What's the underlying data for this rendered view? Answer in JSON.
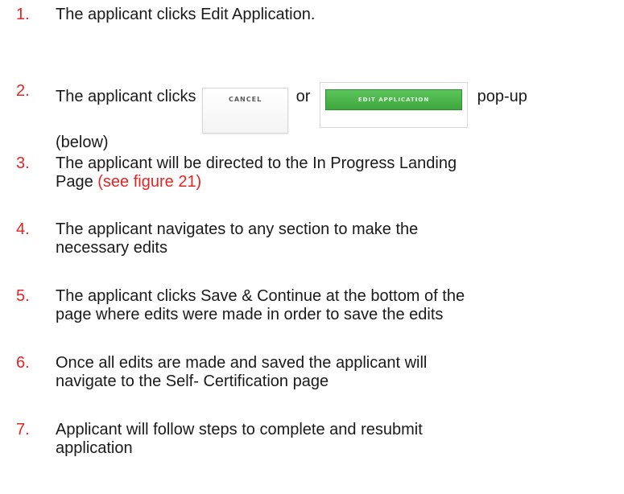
{
  "steps": [
    {
      "number": "1.",
      "text": "The applicant clicks Edit Application."
    },
    {
      "number": "2.",
      "before": "The applicant clicks",
      "cancel_label": "CANCEL",
      "connector": "or",
      "edit_label": "EDIT APPLICATION",
      "after_line1": "pop-up",
      "after_line2": "(below)"
    },
    {
      "number": "3.",
      "line1": "The applicant will be directed to the In Progress Landing",
      "line2_plain": "Page ",
      "line2_ref": "(see figure 21)"
    },
    {
      "number": "4.",
      "line1": "The applicant navigates to any section to make the",
      "line2": "necessary edits"
    },
    {
      "number": "5.",
      "line1": "The applicant  clicks Save & Continue at the bottom of the",
      "line2": "page where edits were made in order to save the edits"
    },
    {
      "number": "6.",
      "line1": "Once all edits are made and saved the applicant will",
      "line2": "navigate to the Self- Certification page"
    },
    {
      "number": "7.",
      "line1": "Applicant will follow steps to complete and resubmit",
      "line2": "application"
    }
  ],
  "colors": {
    "number": "#e8231f",
    "reference": "#e8231f",
    "text": "#1a1a1a",
    "edit_button": "#43ad43"
  }
}
